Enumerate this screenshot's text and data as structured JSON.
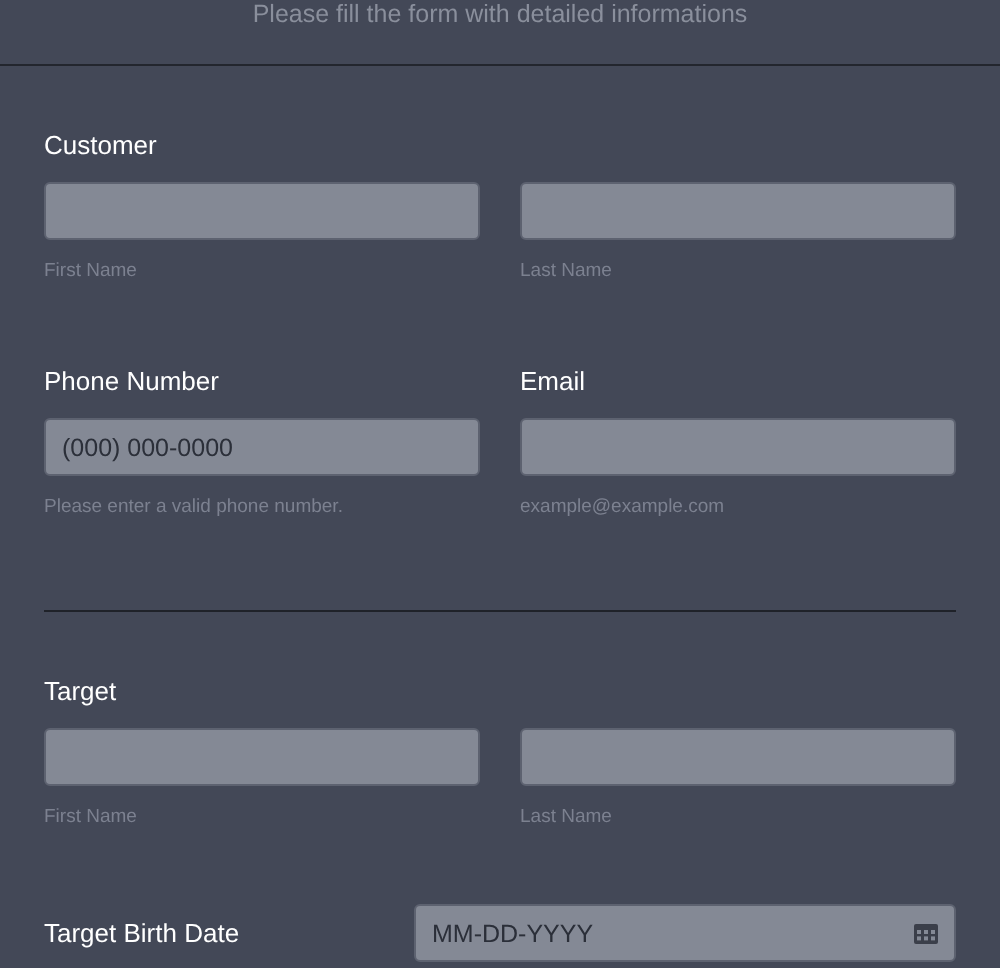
{
  "subtitle": "Please fill the form with detailed informations",
  "rows": [
    {
      "kind": "name",
      "label": "Customer",
      "fields": [
        {
          "sublabel": "First Name"
        },
        {
          "sublabel": "Last Name"
        }
      ]
    },
    {
      "kind": "pair",
      "fields": [
        {
          "label": "Phone Number",
          "placeholder": "(000) 000-0000",
          "sublabel": "Please enter a valid phone number."
        },
        {
          "label": "Email",
          "sublabel": "example@example.com"
        }
      ]
    },
    {
      "kind": "divider"
    },
    {
      "kind": "name",
      "label": "Target",
      "fields": [
        {
          "sublabel": "First Name"
        },
        {
          "sublabel": "Last Name"
        }
      ]
    },
    {
      "kind": "date",
      "label": "Target Birth Date",
      "placeholder": "MM-DD-YYYY"
    }
  ]
}
